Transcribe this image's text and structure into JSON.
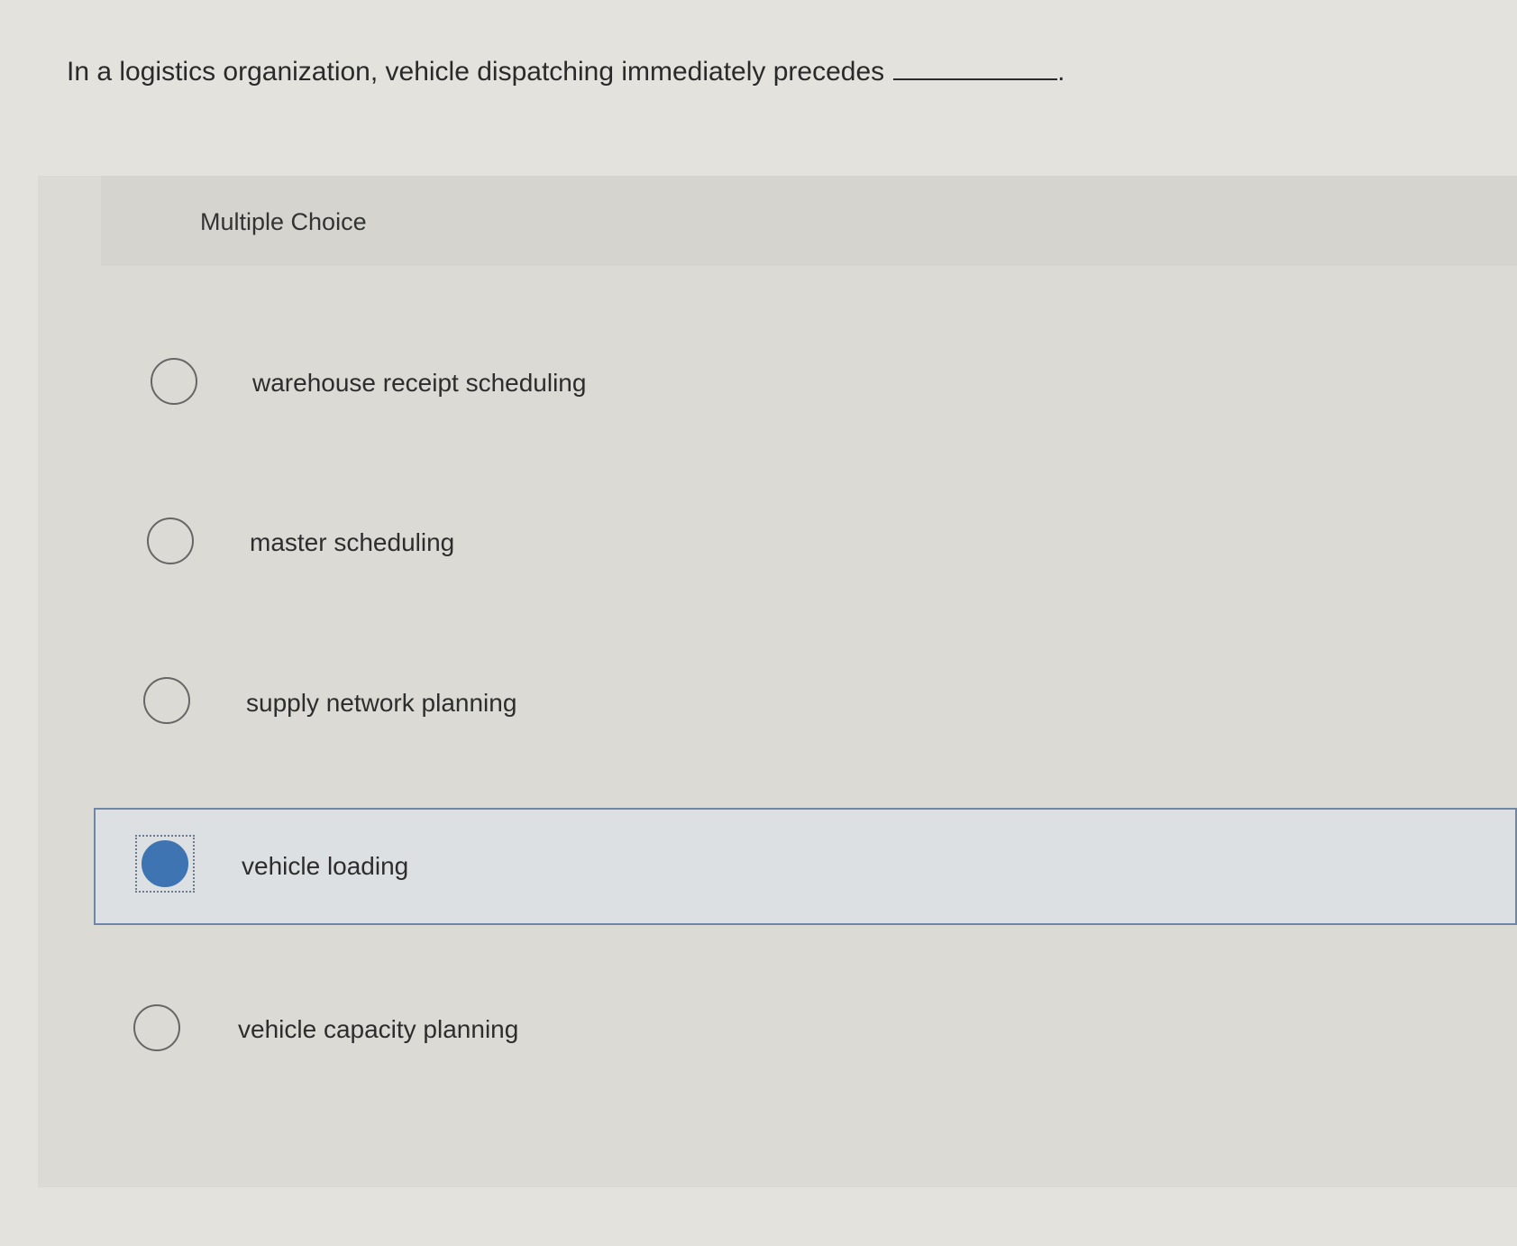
{
  "question": {
    "text": "In a logistics organization, vehicle dispatching immediately precedes",
    "trailing": "."
  },
  "panel": {
    "heading": "Multiple Choice"
  },
  "options": [
    {
      "label": "warehouse receipt scheduling",
      "selected": false
    },
    {
      "label": "master scheduling",
      "selected": false
    },
    {
      "label": "supply network planning",
      "selected": false
    },
    {
      "label": "vehicle loading",
      "selected": true
    },
    {
      "label": "vehicle capacity planning",
      "selected": false
    }
  ],
  "colors": {
    "accent": "#3f74b3",
    "selected_border": "#6e87a8"
  }
}
